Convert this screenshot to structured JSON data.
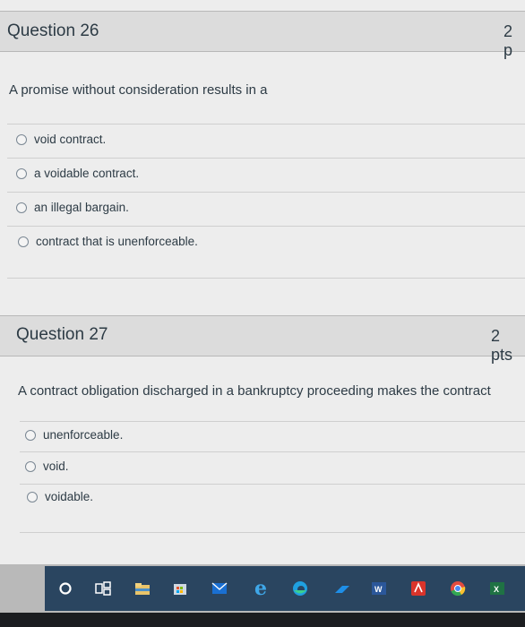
{
  "questions": [
    {
      "title": "Question 26",
      "points": "2 p",
      "text": "A promise without consideration results in a",
      "options": [
        "void contract.",
        "a voidable contract.",
        "an illegal bargain.",
        "contract that is unenforceable."
      ]
    },
    {
      "title": "Question 27",
      "points": "2 pts",
      "text": "A contract obligation discharged in a bankruptcy proceeding makes the contract",
      "options": [
        "unenforceable.",
        "void.",
        "voidable."
      ]
    }
  ],
  "taskbar": {
    "icons": [
      "search-icon",
      "task-view-icon",
      "file-explorer-icon",
      "store-icon",
      "mail-icon",
      "edge-legacy-icon",
      "edge-icon",
      "onedrive-icon",
      "word-icon",
      "acrobat-icon",
      "chrome-icon",
      "excel-icon"
    ]
  },
  "colors": {
    "header_bg": "#dcdcdc",
    "page_bg": "#ededed",
    "taskbar_bg": "#2a4560"
  }
}
